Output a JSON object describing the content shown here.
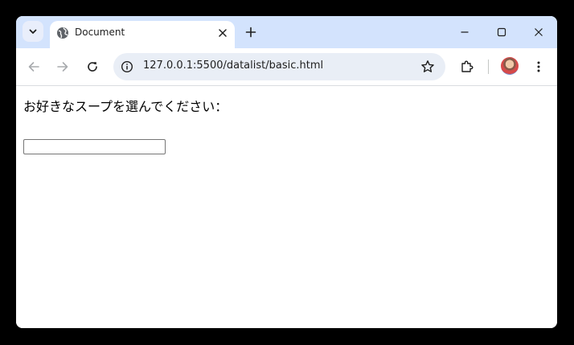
{
  "browser": {
    "tab": {
      "title": "Document"
    },
    "omnibox": {
      "url": "127.0.0.1:5500/datalist/basic.html"
    }
  },
  "page": {
    "label": "お好きなスープを選んでください：",
    "input": {
      "value": "",
      "placeholder": ""
    }
  }
}
